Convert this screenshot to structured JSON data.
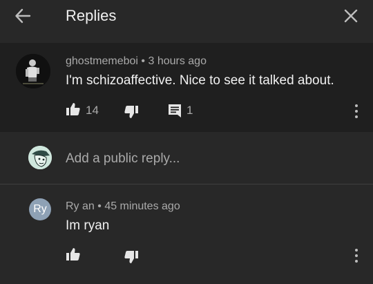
{
  "header": {
    "title": "Replies",
    "back_icon": "arrow-back-icon",
    "close_icon": "close-icon"
  },
  "thread_comment": {
    "author": "ghostmemeboi",
    "time": "3 hours ago",
    "text": "I'm schizoaffective. Nice to see it talked about.",
    "like_count": "14",
    "reply_count": "1"
  },
  "reply_input": {
    "placeholder": "Add a public reply..."
  },
  "replies": [
    {
      "avatar_initials": "Ry",
      "author": "Ry an",
      "time": "45 minutes ago",
      "text": "Im ryan"
    }
  ],
  "separator": "•",
  "colors": {
    "background": "#282828",
    "thread_background": "#1f1f1f",
    "text": "#f1f1f1",
    "secondary_text": "#aaaaaa",
    "initials_avatar": "#8ea1b5"
  }
}
